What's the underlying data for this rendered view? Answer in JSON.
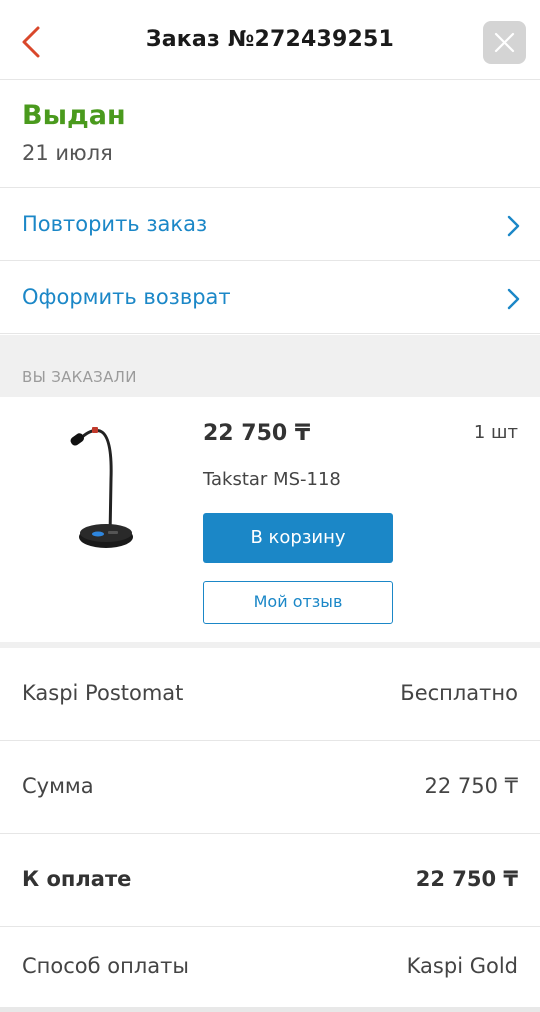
{
  "header": {
    "title": "Заказ №272439251",
    "back_icon": "chevron-left-icon",
    "close_icon": "close-icon",
    "accent_color": "#d9472b"
  },
  "status": {
    "label": "Выдан",
    "date": "21 июля",
    "color": "#4a9a1d"
  },
  "actions": [
    {
      "label": "Повторить заказ",
      "icon": "chevron-right-icon"
    },
    {
      "label": "Оформить возврат",
      "icon": "chevron-right-icon"
    }
  ],
  "ordered_section": {
    "caption": "ВЫ ЗАКАЗАЛИ"
  },
  "product": {
    "price": "22 750 ₸",
    "quantity": "1 шт",
    "name": "Takstar MS-118",
    "cart_button": "В корзину",
    "review_button": "Мой отзыв",
    "image_icon": "microphone-image"
  },
  "summary": [
    {
      "key": "Kaspi Postomat",
      "value": "Бесплатно"
    },
    {
      "key": "Сумма",
      "value": "22 750 ₸"
    },
    {
      "key": "К оплате",
      "value": "22 750 ₸"
    },
    {
      "key": "Способ оплаты",
      "value": "Kaspi Gold"
    }
  ],
  "brand_color": "#1b87c7"
}
